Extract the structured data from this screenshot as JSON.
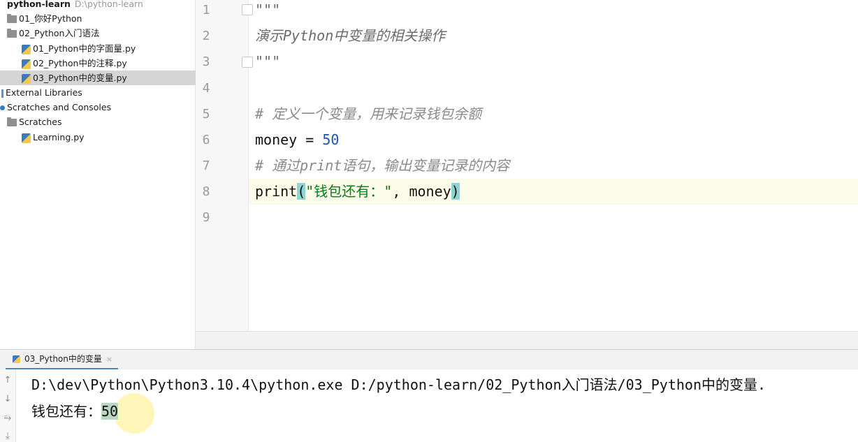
{
  "project_tree": {
    "root": {
      "name": "python-learn",
      "path": "D:\\python-learn"
    },
    "items": [
      {
        "label": "01_你好Python"
      },
      {
        "label": "02_Python入门语法"
      },
      {
        "label": "01_Python中的字面量.py"
      },
      {
        "label": "02_Python中的注释.py"
      },
      {
        "label": "03_Python中的变量.py"
      },
      {
        "label": "External Libraries"
      },
      {
        "label": "Scratches and Consoles"
      },
      {
        "label": "Scratches"
      },
      {
        "label": "Learning.py"
      }
    ]
  },
  "editor": {
    "line_numbers": [
      "1",
      "2",
      "3",
      "4",
      "5",
      "6",
      "7",
      "8",
      "9"
    ],
    "lines": {
      "l1": "\"\"\"",
      "l2": "演示Python中变量的相关操作",
      "l3": "\"\"\"",
      "l5": "# 定义一个变量，用来记录钱包余额",
      "l6_name": "money",
      "l6_op": " = ",
      "l6_val": "50",
      "l7": "# 通过print语句，输出变量记录的内容",
      "l8_func": "print",
      "l8_open": "(",
      "l8_str": "\"钱包还有：\"",
      "l8_rest": ", money",
      "l8_close": ")"
    }
  },
  "run_panel": {
    "tab_label": "03_Python中的变量",
    "tab_close": "×",
    "command": "D:\\dev\\Python\\Python3.10.4\\python.exe D:/python-learn/02_Python入门语法/03_Python中的变量.",
    "output_label": "钱包还有：",
    "output_value": "50",
    "side_icons": [
      "up-arrow-icon",
      "down-arrow-icon",
      "soft-wrap-icon",
      "scroll-to-end-icon"
    ]
  }
}
